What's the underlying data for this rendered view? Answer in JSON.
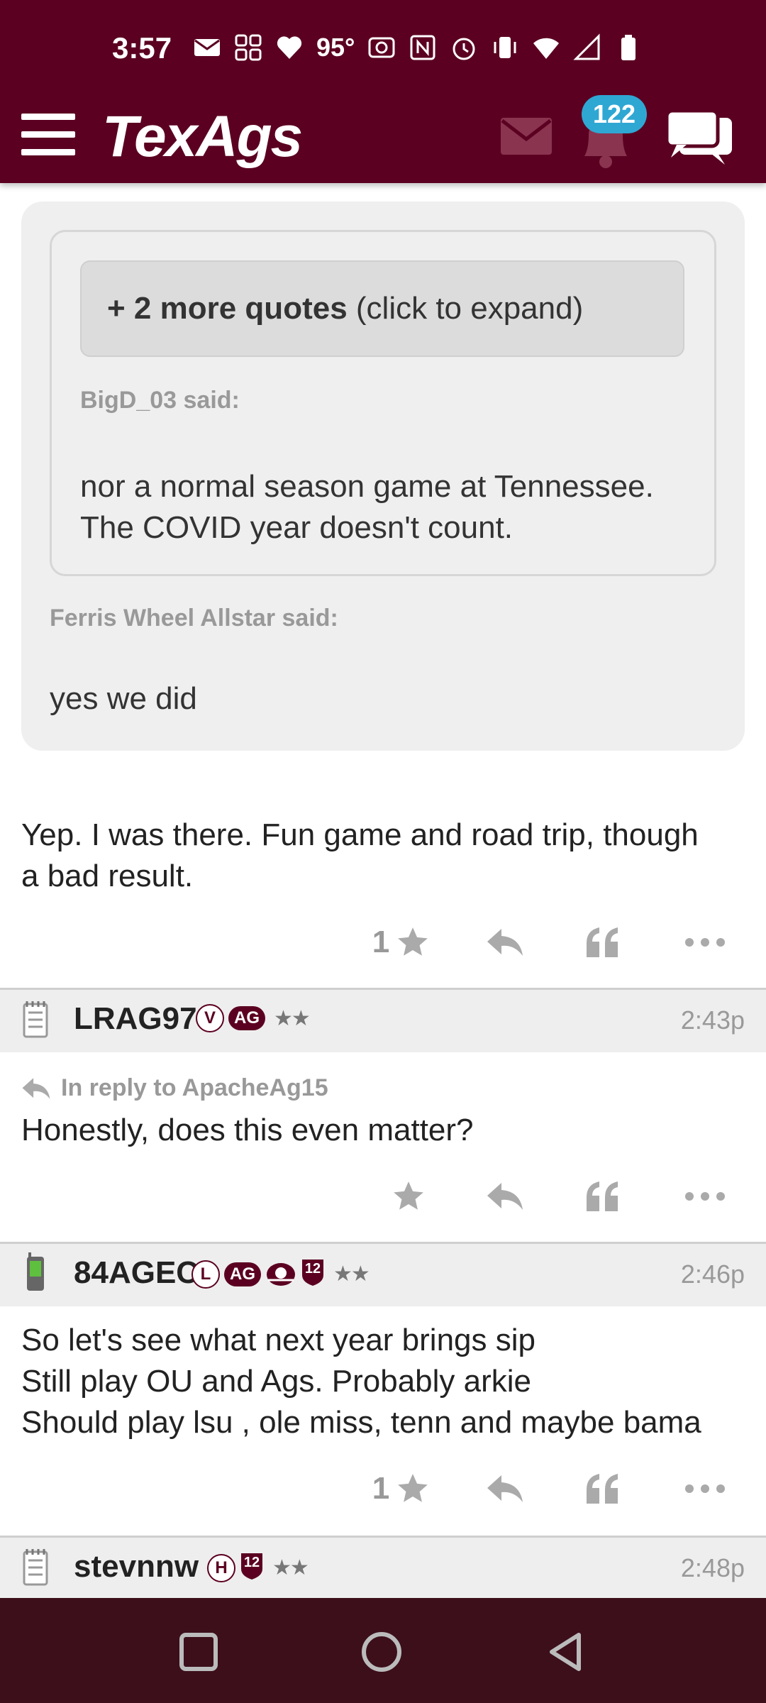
{
  "status_bar": {
    "time": "3:57",
    "temperature": "95°",
    "icons": [
      "mail-icon",
      "grid-icon",
      "heart-icon",
      "nfc-icon",
      "alarm-icon",
      "vibrate-icon",
      "wifi-icon",
      "signal-icon",
      "battery-icon"
    ]
  },
  "header": {
    "logo": "TexAgs",
    "notification_count": "122",
    "brand_color": "#5b0021",
    "badge_color": "#2fa7d3"
  },
  "quote_block": {
    "expand_bold": "+ 2 more quotes",
    "expand_rest": " (click to expand)",
    "inner_author": "BigD_03 said:",
    "inner_text_line1": "nor a normal season game at Tennessee.",
    "inner_text_line2": "The COVID year doesn't count.",
    "outer_author": "Ferris Wheel Allstar said:",
    "outer_text": "yes we did"
  },
  "posts": [
    {
      "text_line1": "Yep. I was there. Fun game and road trip, though",
      "text_line2": "a bad result.",
      "star_count": "1"
    },
    {
      "username": "LRAG97",
      "badge_circle": "V",
      "badge_ag": "AG",
      "stars": "★★",
      "time": "2:43p",
      "reply_to": "In reply to ApacheAg15",
      "text": "Honestly, does this even matter?",
      "star_count": ""
    },
    {
      "username": "84AGEC",
      "badge_circle": "L",
      "badge_ag": "AG",
      "badge_shield": "12",
      "stars": "★★",
      "time": "2:46p",
      "text_line1": "So let's see what next year brings sip",
      "text_line2": "Still play OU and Ags. Probably arkie",
      "text_line3": "Should play lsu , ole miss, tenn and maybe bama",
      "star_count": "1"
    },
    {
      "username": "stevnnw",
      "badge_circle": "H",
      "badge_shield": "12",
      "stars": "★★",
      "time": "2:48p"
    }
  ]
}
